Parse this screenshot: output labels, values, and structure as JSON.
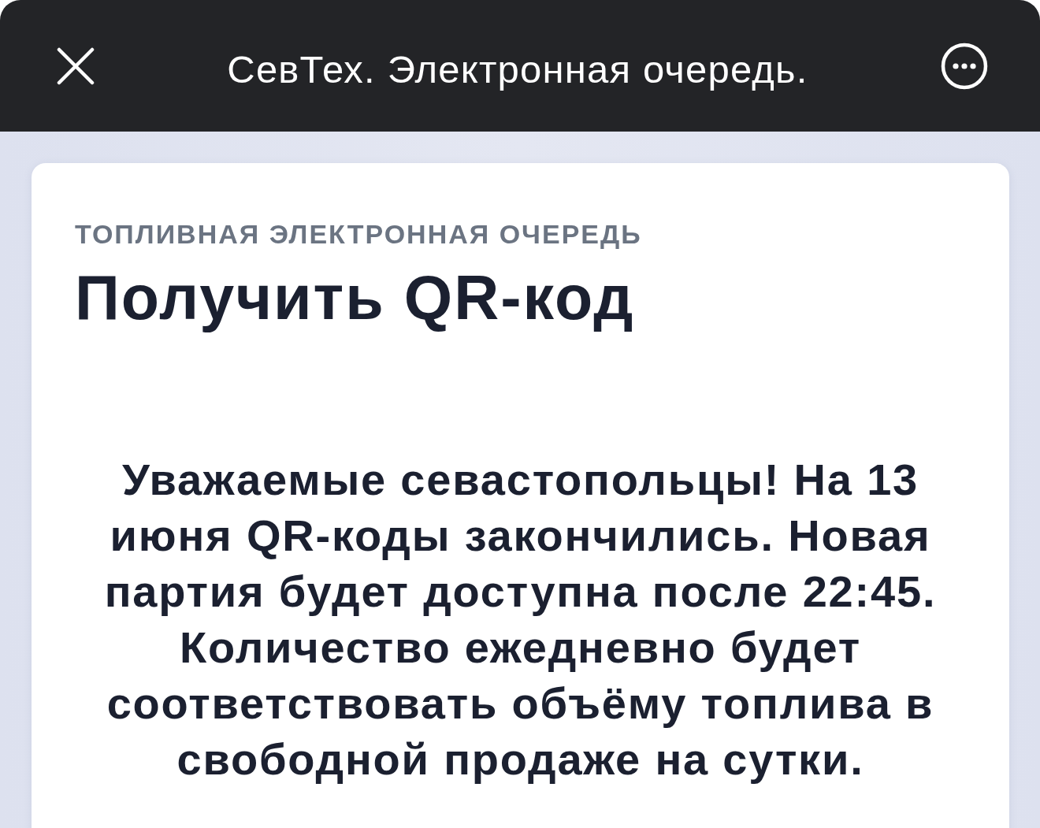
{
  "header": {
    "title": "СевТех. Электронная очередь."
  },
  "card": {
    "kicker": "ТОПЛИВНАЯ ЭЛЕКТРОННАЯ ОЧЕРЕДЬ",
    "title": "Получить QR-код",
    "message": "Уважаемые севастопольцы! На 13 июня QR-коды закончились. Новая партия будет доступна после 22:45. Количество ежедневно будет соответствовать объёму топлива в свободной продаже на сутки."
  }
}
